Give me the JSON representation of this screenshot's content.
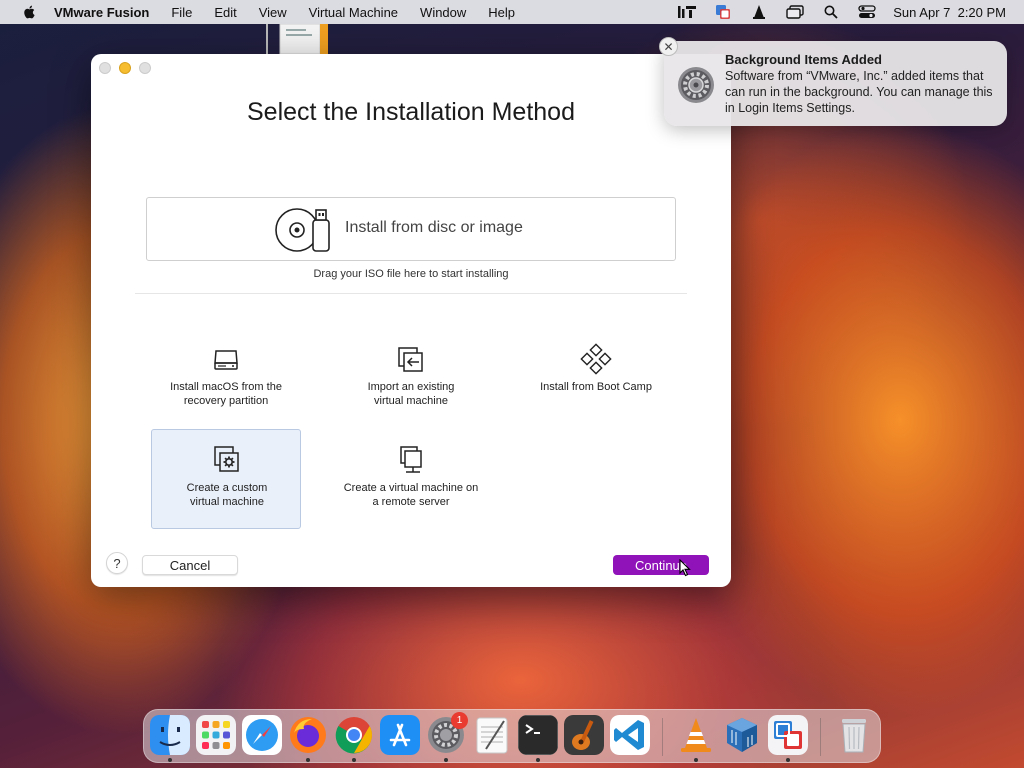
{
  "menubar": {
    "app_name": "VMware Fusion",
    "menus": [
      "File",
      "Edit",
      "View",
      "Virtual Machine",
      "Window",
      "Help"
    ],
    "clock": "Sun Apr 7  2:20 PM"
  },
  "dialog": {
    "title": "Select the Installation Method",
    "disc_option": "Install from disc or image",
    "drag_hint": "Drag your ISO file here to start installing",
    "options": [
      {
        "label": "Install macOS from the\nrecovery partition",
        "icon": "hard-drive-icon",
        "selected": false
      },
      {
        "label": "Import an existing\nvirtual machine",
        "icon": "import-vm-icon",
        "selected": false
      },
      {
        "label": "Install from Boot Camp",
        "icon": "boot-camp-icon",
        "selected": false
      },
      {
        "label": "Create a custom\nvirtual machine",
        "icon": "custom-vm-icon",
        "selected": true
      },
      {
        "label": "Create a virtual machine on\na remote server",
        "icon": "remote-server-icon",
        "selected": false
      }
    ],
    "help_label": "?",
    "cancel_label": "Cancel",
    "continue_label": "Continue"
  },
  "notification": {
    "close_label": "✕",
    "title": "Background Items Added",
    "body": "Software from “VMware, Inc.” added items that can run in the background. You can manage this in Login Items Settings."
  },
  "dock": {
    "apps": [
      "Finder",
      "Launchpad",
      "Safari",
      "Firefox",
      "Chrome",
      "App Store",
      "System Settings",
      "TextEdit",
      "Terminal",
      "GarageBand",
      "Visual Studio Code",
      "VLC",
      "VirtualBox",
      "VMware Fusion",
      "Trash"
    ],
    "settings_badge": "1"
  },
  "colors": {
    "accent": "#8f13b8",
    "selection": "#eaf0fa"
  }
}
